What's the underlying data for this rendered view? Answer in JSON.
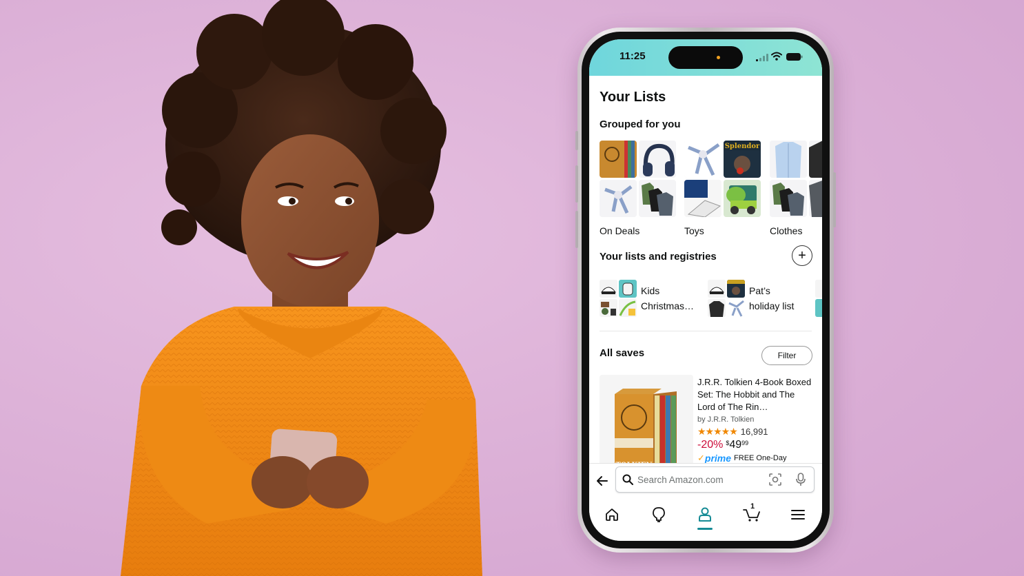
{
  "background": {
    "color": "#dcb3d8"
  },
  "status_bar": {
    "time": "11:25",
    "icons": [
      "cellular-signal-icon",
      "wifi-icon",
      "battery-icon"
    ]
  },
  "page": {
    "title": "Your Lists",
    "grouped": {
      "heading": "Grouped for you",
      "groups": [
        {
          "label": "On Deals",
          "thumbs": [
            "book-box-set",
            "headphones",
            "robot-figure",
            "tshirts"
          ]
        },
        {
          "label": "Toys",
          "thumbs": [
            "robot-figure",
            "splendor-game",
            "space-shuttle-lego",
            "dino-truck"
          ]
        },
        {
          "label": "Clothes",
          "thumbs": [
            "dress-shirt",
            "dark-shirt",
            "tshirts",
            "gray-tshirt"
          ]
        }
      ]
    },
    "registries": {
      "heading": "Your lists and registries",
      "add_icon": "plus-icon",
      "lists": [
        {
          "line1": "Kids",
          "line2": "Christmas…"
        },
        {
          "line1": "Pat’s",
          "line2": "holiday list"
        }
      ]
    },
    "saves": {
      "heading": "All saves",
      "filter_label": "Filter",
      "item": {
        "title": "J.R.R. Tolkien 4-Book Boxed Set: The Hobbit and The Lord of The Rin…",
        "author": "by J.R.R. Tolkien",
        "rating_stars": 4.8,
        "stars_glyph": "★★★★★",
        "rating_count": "16,991",
        "discount": "-20%",
        "price_symbol": "$",
        "price_whole": "49",
        "price_fraction": "99",
        "prime_check": "✓",
        "prime_label": "prime",
        "delivery": "FREE One-Day",
        "image_alt": "Tolkien box set"
      }
    }
  },
  "search": {
    "placeholder": "Search Amazon.com",
    "value": ""
  },
  "bottom_nav": {
    "items": [
      {
        "name": "home",
        "icon": "home-icon"
      },
      {
        "name": "inspire",
        "icon": "lightbulb-icon"
      },
      {
        "name": "account",
        "icon": "person-icon",
        "active": true
      },
      {
        "name": "cart",
        "icon": "cart-icon",
        "badge": "1"
      },
      {
        "name": "menu",
        "icon": "menu-icon"
      }
    ],
    "accent": "#168b95"
  }
}
